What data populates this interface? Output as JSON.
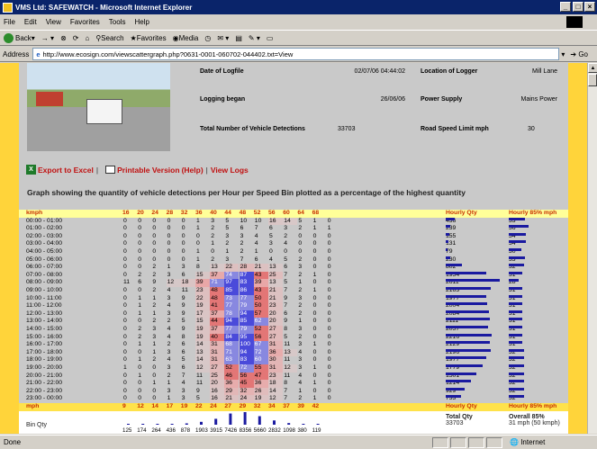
{
  "window": {
    "title": "VMS Ltd: SAFEWATCH - Microsoft Internet Explorer",
    "controls": [
      "_",
      "□",
      "×"
    ]
  },
  "menu": [
    "File",
    "Edit",
    "View",
    "Favorites",
    "Tools",
    "Help"
  ],
  "toolbar": {
    "back": "Back",
    "search": "Search",
    "favorites": "Favorites",
    "media": "Media"
  },
  "address": {
    "label": "Address",
    "url": "http://www.ecosign.com/viewscattergraph.php?0631-0001-060702-044402.txt=View",
    "go": "Go"
  },
  "status": {
    "text": "Done",
    "zone": "Internet"
  },
  "info": {
    "date_label": "Date of Logfile",
    "date_value": "02/07/06 04:44:02",
    "location_label": "Location of Logger",
    "location_value": "Mill Lane",
    "began_label": "Logging began",
    "began_value": "26/06/06",
    "power_label": "Power Supply",
    "power_value": "Mains Power",
    "total_label": "Total Number of Vehicle Detections",
    "total_value": "33703",
    "limit_label": "Road Speed Limit mph",
    "limit_value": "30"
  },
  "links": {
    "excel": "Export to Excel",
    "printable": "Printable Version",
    "help": "(Help)",
    "logs": "View Logs",
    "sep": "|"
  },
  "graph_title": "Graph showing the quantity of vehicle detections per Hour per Speed Bin plotted as a percentage of the highest quantity",
  "table": {
    "header_label": "kmph",
    "kmph_bins": [
      "16",
      "20",
      "24",
      "28",
      "32",
      "36",
      "40",
      "44",
      "48",
      "52",
      "56",
      "60",
      "64",
      "68"
    ],
    "qty_header": "Hourly Qty",
    "p85_header": "Hourly 85% mph",
    "footer_label": "mph",
    "mph_bins": [
      "9",
      "12",
      "14",
      "17",
      "19",
      "22",
      "24",
      "27",
      "29",
      "32",
      "34",
      "37",
      "39",
      "42"
    ],
    "rows": [
      {
        "time": "00:00 - 01:00",
        "v": [
          "0",
          "0",
          "0",
          "0",
          "0",
          "1",
          "3",
          "5",
          "10",
          "10",
          "16",
          "14",
          "5",
          "1",
          "0"
        ],
        "qty": "436",
        "p85": "33",
        "qv": 436,
        "pv": 33
      },
      {
        "time": "01:00 - 02:00",
        "v": [
          "0",
          "0",
          "0",
          "0",
          "0",
          "1",
          "2",
          "5",
          "6",
          "7",
          "6",
          "3",
          "2",
          "1",
          "1"
        ],
        "qty": "239",
        "p85": "36",
        "qv": 239,
        "pv": 36
      },
      {
        "time": "02:00 - 03:00",
        "v": [
          "0",
          "0",
          "0",
          "0",
          "0",
          "0",
          "2",
          "3",
          "3",
          "4",
          "5",
          "2",
          "0",
          "0",
          "0"
        ],
        "qty": "155",
        "p85": "34",
        "qv": 155,
        "pv": 34
      },
      {
        "time": "03:00 - 04:00",
        "v": [
          "0",
          "0",
          "0",
          "0",
          "0",
          "0",
          "1",
          "2",
          "2",
          "4",
          "3",
          "4",
          "0",
          "0",
          "0"
        ],
        "qty": "131",
        "p85": "34",
        "qv": 131,
        "pv": 34
      },
      {
        "time": "04:00 - 05:00",
        "v": [
          "0",
          "0",
          "0",
          "0",
          "0",
          "1",
          "0",
          "1",
          "2",
          "1",
          "0",
          "0",
          "0",
          "0",
          "0"
        ],
        "qty": "79",
        "p85": "30",
        "qv": 79,
        "pv": 30
      },
      {
        "time": "05:00 - 06:00",
        "v": [
          "0",
          "0",
          "0",
          "0",
          "0",
          "1",
          "2",
          "3",
          "7",
          "6",
          "4",
          "5",
          "2",
          "0",
          "0"
        ],
        "qty": "230",
        "p85": "33",
        "qv": 230,
        "pv": 33
      },
      {
        "time": "06:00 - 07:00",
        "v": [
          "0",
          "0",
          "2",
          "1",
          "3",
          "8",
          "13",
          "22",
          "28",
          "21",
          "13",
          "6",
          "3",
          "0",
          "0"
        ],
        "qty": "802",
        "p85": "32",
        "qv": 802,
        "pv": 32
      },
      {
        "time": "07:00 - 08:00",
        "v": [
          "0",
          "2",
          "2",
          "3",
          "6",
          "15",
          "37",
          "74",
          "87",
          "43",
          "25",
          "7",
          "2",
          "1",
          "0"
        ],
        "qty": "1954",
        "p85": "31",
        "qv": 1954,
        "pv": 31
      },
      {
        "time": "08:00 - 09:00",
        "v": [
          "11",
          "6",
          "9",
          "12",
          "18",
          "39",
          "71",
          "97",
          "83",
          "39",
          "13",
          "5",
          "1",
          "0",
          "0"
        ],
        "qty": "2611",
        "p85": "28",
        "qv": 2611,
        "pv": 28
      },
      {
        "time": "09:00 - 10:00",
        "v": [
          "0",
          "0",
          "2",
          "4",
          "11",
          "23",
          "48",
          "85",
          "86",
          "43",
          "21",
          "7",
          "2",
          "1",
          "0"
        ],
        "qty": "2163",
        "p85": "31",
        "qv": 2163,
        "pv": 31
      },
      {
        "time": "10:00 - 11:00",
        "v": [
          "0",
          "1",
          "1",
          "3",
          "9",
          "22",
          "48",
          "73",
          "77",
          "50",
          "21",
          "9",
          "3",
          "0",
          "0"
        ],
        "qty": "1977",
        "p85": "31",
        "qv": 1977,
        "pv": 31
      },
      {
        "time": "11:00 - 12:00",
        "v": [
          "0",
          "1",
          "2",
          "4",
          "9",
          "19",
          "41",
          "77",
          "79",
          "50",
          "23",
          "7",
          "2",
          "0",
          "0"
        ],
        "qty": "2004",
        "p85": "31",
        "qv": 2004,
        "pv": 31
      },
      {
        "time": "12:00 - 13:00",
        "v": [
          "0",
          "1",
          "1",
          "3",
          "9",
          "17",
          "37",
          "78",
          "94",
          "57",
          "20",
          "6",
          "2",
          "0",
          "0"
        ],
        "qty": "2084",
        "p85": "31",
        "qv": 2084,
        "pv": 31
      },
      {
        "time": "13:00 - 14:00",
        "v": [
          "0",
          "0",
          "2",
          "2",
          "5",
          "15",
          "44",
          "94",
          "85",
          "62",
          "20",
          "9",
          "1",
          "0",
          "0"
        ],
        "qty": "2111",
        "p85": "31",
        "qv": 2111,
        "pv": 31
      },
      {
        "time": "14:00 - 15:00",
        "v": [
          "0",
          "2",
          "3",
          "4",
          "9",
          "19",
          "37",
          "77",
          "79",
          "52",
          "27",
          "8",
          "3",
          "0",
          "0"
        ],
        "qty": "2057",
        "p85": "31",
        "qv": 2057,
        "pv": 31
      },
      {
        "time": "15:00 - 16:00",
        "v": [
          "0",
          "2",
          "3",
          "4",
          "8",
          "19",
          "40",
          "84",
          "95",
          "56",
          "27",
          "5",
          "2",
          "0",
          "0"
        ],
        "qty": "2216",
        "p85": "31",
        "qv": 2216,
        "pv": 31
      },
      {
        "time": "16:00 - 17:00",
        "v": [
          "0",
          "1",
          "1",
          "2",
          "6",
          "14",
          "31",
          "68",
          "100",
          "67",
          "31",
          "11",
          "3",
          "1",
          "0"
        ],
        "qty": "2129",
        "p85": "31",
        "qv": 2129,
        "pv": 31
      },
      {
        "time": "17:00 - 18:00",
        "v": [
          "0",
          "0",
          "1",
          "3",
          "6",
          "13",
          "31",
          "71",
          "94",
          "72",
          "36",
          "13",
          "4",
          "0",
          "0"
        ],
        "qty": "2196",
        "p85": "32",
        "qv": 2196,
        "pv": 32
      },
      {
        "time": "18:00 - 19:00",
        "v": [
          "0",
          "1",
          "2",
          "4",
          "5",
          "14",
          "31",
          "63",
          "83",
          "60",
          "30",
          "11",
          "3",
          "0",
          "0"
        ],
        "qty": "1977",
        "p85": "32",
        "qv": 1977,
        "pv": 32
      },
      {
        "time": "19:00 - 20:00",
        "v": [
          "1",
          "0",
          "0",
          "3",
          "6",
          "12",
          "27",
          "52",
          "72",
          "55",
          "31",
          "12",
          "3",
          "1",
          "0"
        ],
        "qty": "1779",
        "p85": "32",
        "qv": 1779,
        "pv": 32
      },
      {
        "time": "20:00 - 21:00",
        "v": [
          "0",
          "1",
          "0",
          "2",
          "7",
          "11",
          "25",
          "46",
          "56",
          "47",
          "23",
          "11",
          "4",
          "0",
          "0"
        ],
        "qty": "1501",
        "p85": "32",
        "qv": 1501,
        "pv": 32
      },
      {
        "time": "21:00 - 22:00",
        "v": [
          "0",
          "0",
          "1",
          "1",
          "4",
          "11",
          "20",
          "36",
          "45",
          "36",
          "18",
          "8",
          "4",
          "1",
          "0"
        ],
        "qty": "1214",
        "p85": "32",
        "qv": 1214,
        "pv": 32
      },
      {
        "time": "22:00 - 23:00",
        "v": [
          "0",
          "0",
          "0",
          "3",
          "3",
          "9",
          "16",
          "29",
          "32",
          "26",
          "14",
          "7",
          "1",
          "0",
          "0"
        ],
        "qty": "929",
        "p85": "32",
        "qv": 929,
        "pv": 32
      },
      {
        "time": "23:00 - 00:00",
        "v": [
          "0",
          "0",
          "0",
          "1",
          "3",
          "5",
          "16",
          "21",
          "24",
          "19",
          "12",
          "7",
          "2",
          "1",
          "0"
        ],
        "qty": "733",
        "p85": "32",
        "qv": 733,
        "pv": 32
      }
    ]
  },
  "bins": {
    "label": "Bin Qty",
    "counts": [
      "125",
      "174",
      "264",
      "436",
      "878",
      "1903",
      "3915",
      "7426",
      "8356",
      "5660",
      "2832",
      "1098",
      "380",
      "119"
    ],
    "values": [
      125,
      174,
      264,
      436,
      878,
      1903,
      3915,
      7426,
      8356,
      5660,
      2832,
      1098,
      380,
      119
    ],
    "total_label": "Total Qty",
    "total_value": "33703",
    "overall_label": "Overall 85%",
    "overall_value": "31 mph (50 kmph)"
  },
  "colors": {
    "accent_yellow": "#ffd43a",
    "header_bg": "#ffff99",
    "bar": "#1a1aa0",
    "page_bg": "#c9c9c9"
  }
}
